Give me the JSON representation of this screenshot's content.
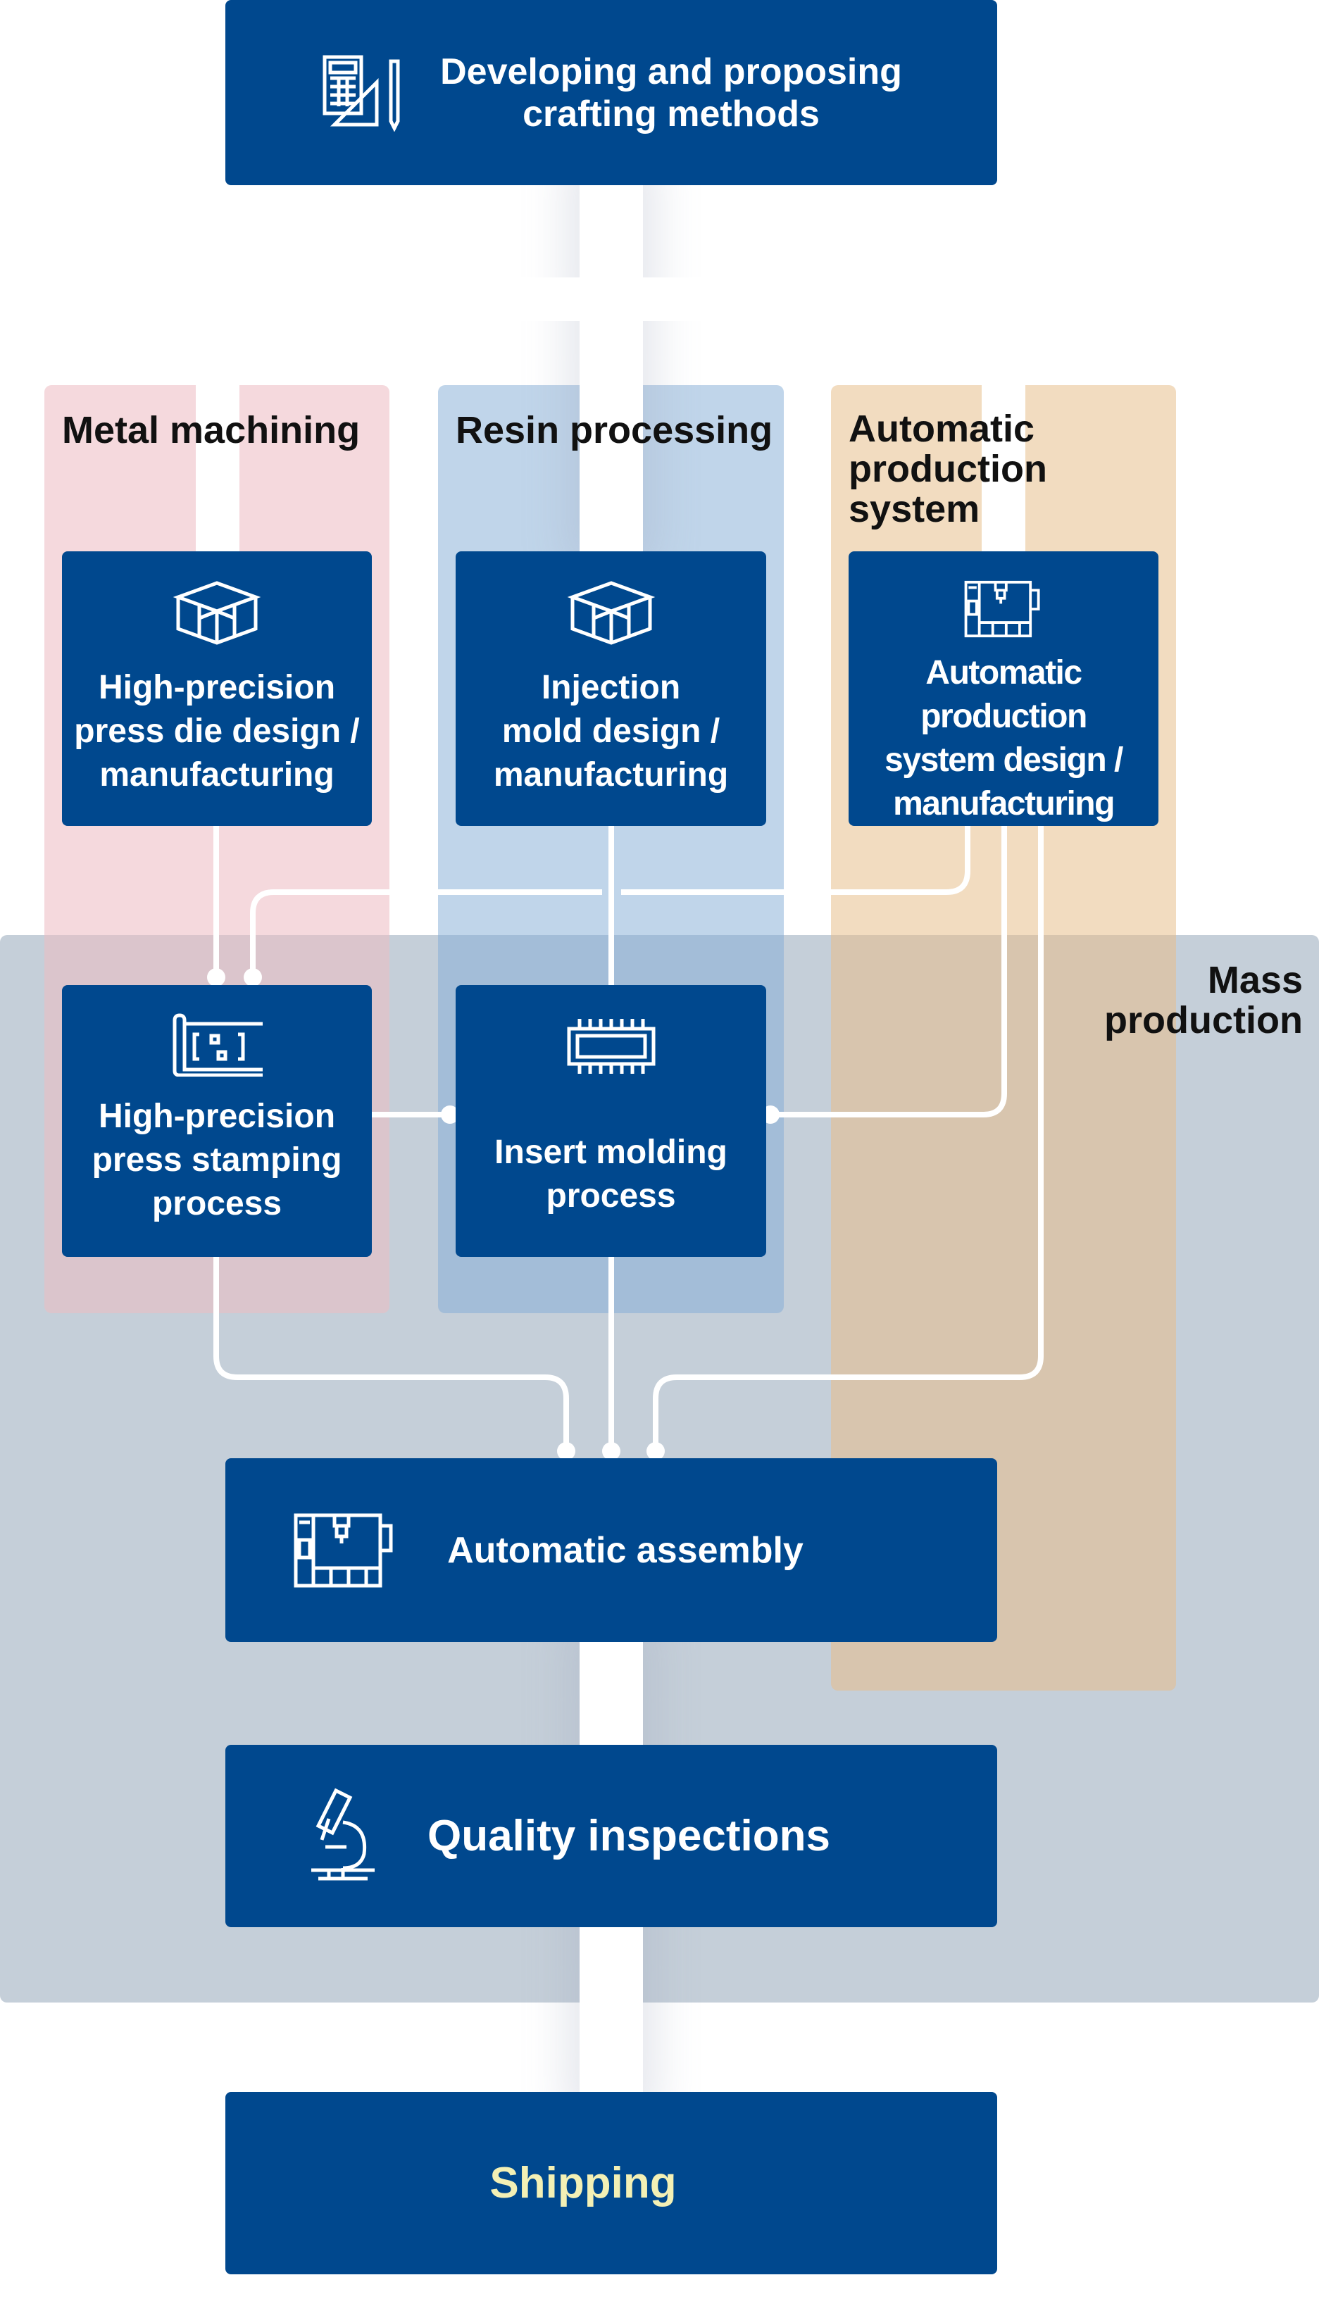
{
  "top": {
    "label_line1": "Developing and proposing",
    "label_line2": "crafting methods",
    "icon": "calculator-ruler-pencil-icon"
  },
  "categories": {
    "metal": {
      "label": "Metal machining",
      "color": "#f5d9dd"
    },
    "resin": {
      "label": "Resin processing",
      "color": "#c0d5ea"
    },
    "automatic": {
      "label_lines": [
        "Automatic",
        "production",
        "system"
      ],
      "color": "#f2dcc0"
    }
  },
  "mass_production": {
    "label_lines": [
      "Mass",
      "production"
    ],
    "color": "#c5cfd9"
  },
  "boxes": {
    "press_die": {
      "lines": [
        "High-precision",
        "press die  design /",
        "manufacturing"
      ],
      "icon": "mold-block-icon"
    },
    "injection_mold": {
      "lines": [
        "Injection",
        "mold design /",
        "manufacturing"
      ],
      "icon": "mold-block-icon"
    },
    "auto_system": {
      "lines": [
        "Automatic production",
        "system design /",
        "manufacturing"
      ],
      "icon": "automated-machine-icon"
    },
    "press_stamping": {
      "lines": [
        "High-precision",
        "press stamping",
        "process"
      ],
      "icon": "blueprint-icon"
    },
    "insert_molding": {
      "lines": [
        "Insert molding",
        "process"
      ],
      "icon": "chip-icon"
    },
    "assembly": {
      "label": "Automatic assembly",
      "icon": "automated-machine-icon"
    },
    "quality": {
      "label": "Quality inspections",
      "icon": "microscope-icon"
    },
    "shipping": {
      "label": "Shipping",
      "color": "#f3f0b5"
    }
  },
  "colors": {
    "box": "#00488e",
    "connector": "#ffffff"
  }
}
